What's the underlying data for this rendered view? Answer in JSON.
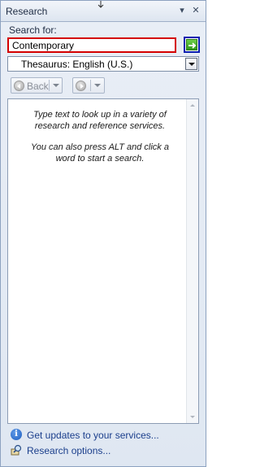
{
  "pane": {
    "title": "Research",
    "dropdown_glyph": "▾",
    "close_glyph": "✕"
  },
  "search": {
    "label": "Search for:",
    "value": "Contemporary"
  },
  "source": {
    "selected": "Thesaurus: English (U.S.)"
  },
  "nav": {
    "back_label": "Back"
  },
  "results": {
    "line1": "Type text to look up in a variety of research and reference services.",
    "line2": "You can also press ALT and click a word to start a search."
  },
  "footer": {
    "updates_label": "Get updates to your services...",
    "options_label": "Research options..."
  },
  "colors": {
    "highlight_red": "#d40000",
    "highlight_blue": "#0a1fb0",
    "go_green": "#2f9a1a",
    "link_blue": "#1b3f8c"
  },
  "icons": {
    "go": "go-arrow-icon",
    "info": "info-icon",
    "options": "magnifier-book-icon"
  }
}
